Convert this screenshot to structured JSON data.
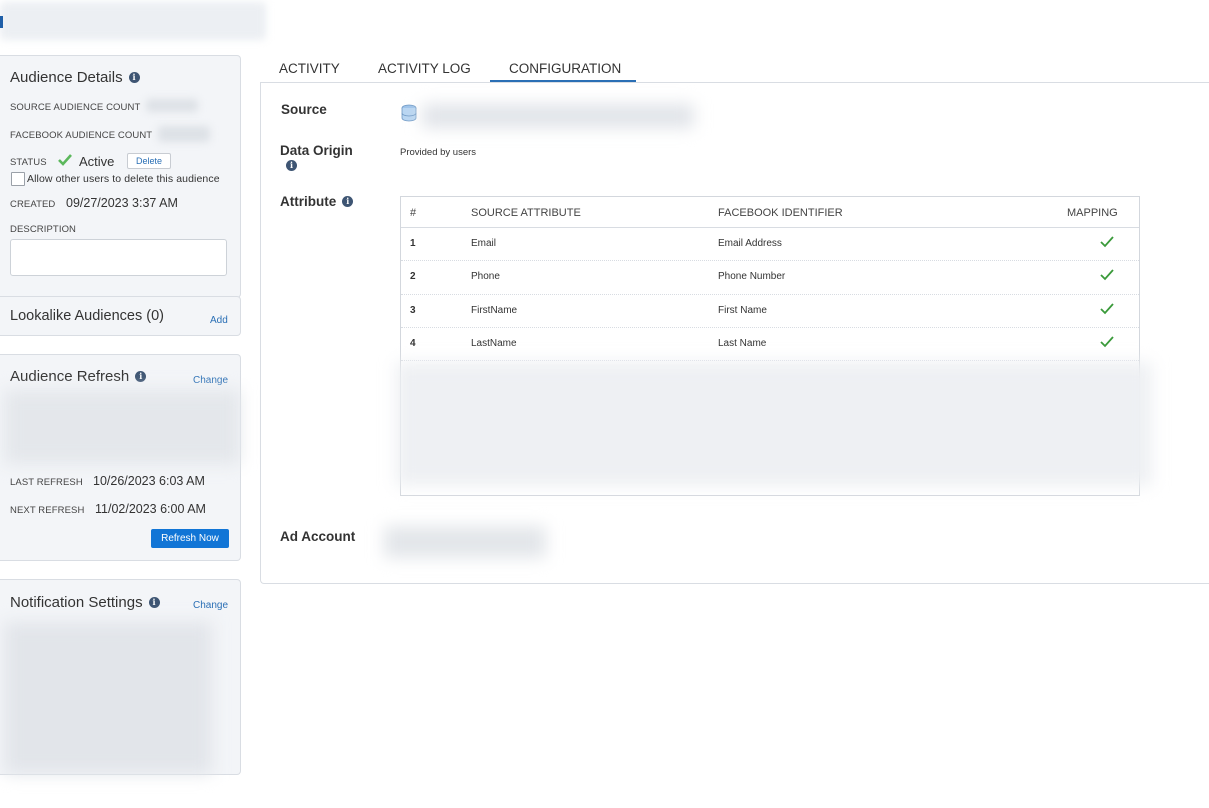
{
  "audience_details": {
    "title": "Audience Details",
    "source_count_label": "SOURCE AUDIENCE COUNT",
    "facebook_count_label": "FACEBOOK AUDIENCE COUNT",
    "status_label": "STATUS",
    "status_value": "Active",
    "delete_button": "Delete",
    "allow_delete_label": "Allow other users to delete this audience",
    "created_label": "CREATED",
    "created_value": "09/27/2023 3:37 AM",
    "description_label": "DESCRIPTION",
    "description_value": ""
  },
  "lookalike": {
    "title": "Lookalike Audiences",
    "count": "(0)",
    "add_link": "Add"
  },
  "refresh": {
    "title": "Audience Refresh",
    "change_link": "Change",
    "last_label": "LAST REFRESH",
    "last_value": "10/26/2023 6:03 AM",
    "next_label": "NEXT REFRESH",
    "next_value": "11/02/2023 6:00 AM",
    "refresh_button": "Refresh Now"
  },
  "notification": {
    "title": "Notification Settings",
    "change_link": "Change"
  },
  "tabs": [
    {
      "label": "ACTIVITY"
    },
    {
      "label": "ACTIVITY LOG"
    },
    {
      "label": "CONFIGURATION",
      "active": true
    }
  ],
  "config": {
    "source_label": "Source",
    "data_origin_label": "Data Origin",
    "data_origin_value": "Provided by users",
    "attribute_label": "Attribute",
    "ad_account_label": "Ad Account"
  },
  "attribute_table": {
    "headers": [
      "#",
      "SOURCE ATTRIBUTE",
      "FACEBOOK IDENTIFIER",
      "MAPPING"
    ],
    "rows": [
      {
        "num": "1",
        "source": "Email",
        "facebook": "Email Address",
        "mapped": true
      },
      {
        "num": "2",
        "source": "Phone",
        "facebook": "Phone Number",
        "mapped": true
      },
      {
        "num": "3",
        "source": "FirstName",
        "facebook": "First Name",
        "mapped": true
      },
      {
        "num": "4",
        "source": "LastName",
        "facebook": "Last Name",
        "mapped": true
      }
    ]
  },
  "colors": {
    "accent": "#2a6fb5",
    "primary_button": "#1175d6",
    "check_green": "#3a9a3a",
    "status_green": "#5cb85c"
  }
}
